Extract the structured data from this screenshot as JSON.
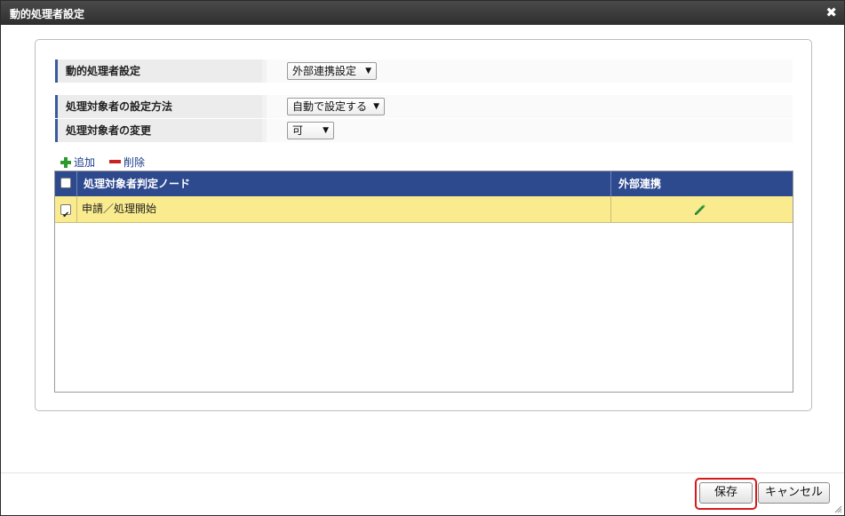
{
  "dialog": {
    "title": "動的処理者設定",
    "close_glyph": "✖"
  },
  "form": {
    "rows": [
      {
        "label": "動的処理者設定",
        "value": "外部連携設定"
      },
      {
        "label": "処理対象者の設定方法",
        "value": "自動で設定する"
      },
      {
        "label": "処理対象者の変更",
        "value": "可"
      }
    ]
  },
  "toolbar": {
    "add_label": "追加",
    "delete_label": "削除"
  },
  "grid": {
    "columns": [
      "処理対象者判定ノード",
      "外部連携"
    ],
    "rows": [
      {
        "checked": true,
        "node": "申請／処理開始",
        "action_icon": "pencil-icon"
      }
    ]
  },
  "footer": {
    "save_label": "保存",
    "cancel_label": "キャンセル"
  },
  "colors": {
    "title_bar": "#333333",
    "grid_header": "#2e4a8f",
    "selected_row": "#faeb8e",
    "highlight": "#d61a1a"
  }
}
